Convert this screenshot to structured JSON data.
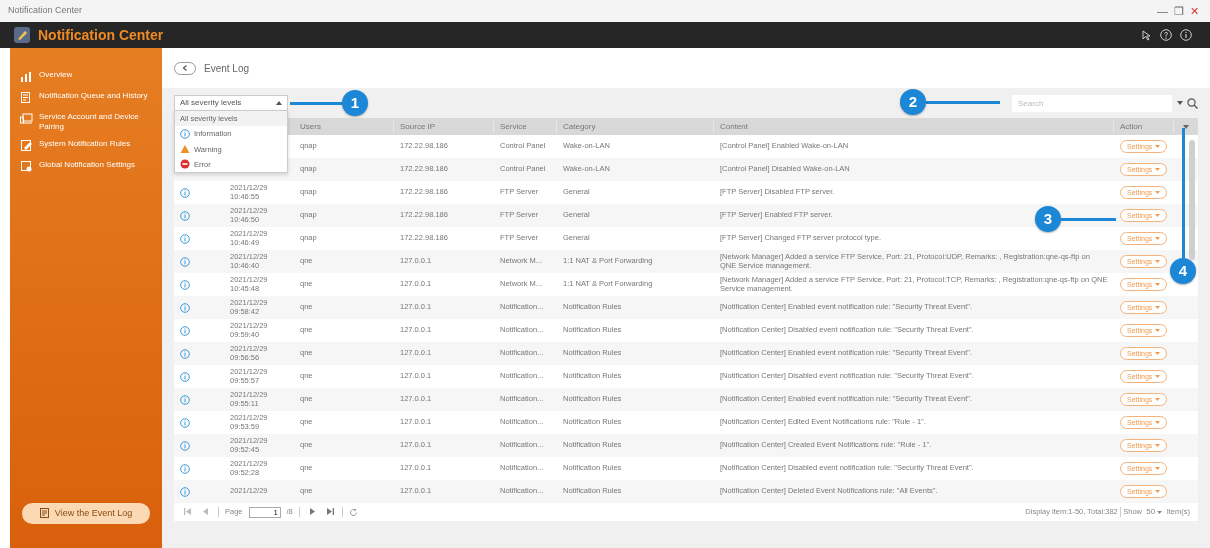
{
  "window": {
    "title": "Notification Center",
    "controls": [
      "—",
      "❐",
      "✕"
    ]
  },
  "header": {
    "title": "Notification Center"
  },
  "sidebar": {
    "items": [
      {
        "label": "Overview",
        "selected": false
      },
      {
        "label": "Notification Queue and History",
        "selected": false
      },
      {
        "label": "Service Account and Device Pairing",
        "selected": false
      },
      {
        "label": "System Notification Rules",
        "selected": false
      },
      {
        "label": "Global Notification Settings",
        "selected": false
      }
    ],
    "button": "View the Event Log"
  },
  "page": {
    "title": "Event Log"
  },
  "filter": {
    "value": "All severity levels",
    "expanded": true,
    "options": [
      {
        "label": "All severity levels",
        "kind": "all",
        "selected": true
      },
      {
        "label": "Information",
        "kind": "info",
        "selected": false
      },
      {
        "label": "Warning",
        "kind": "warning",
        "selected": false
      },
      {
        "label": "Error",
        "kind": "error",
        "selected": false
      }
    ]
  },
  "search": {
    "placeholder": "Search"
  },
  "table": {
    "columns": [
      "Users",
      "Source IP",
      "Service",
      "Category",
      "Content",
      "Action"
    ],
    "rows": [
      {
        "date": null,
        "time": null,
        "user": "qnap",
        "ip": "172.22.98.186",
        "service": "Control Panel",
        "category": "Wake-on-LAN",
        "content": "[Control Panel] Enabled Wake-on-LAN",
        "action": "Settings"
      },
      {
        "date": null,
        "time": null,
        "user": "qnap",
        "ip": "172.22.98.186",
        "service": "Control Panel",
        "category": "Wake-on-LAN",
        "content": "[Control Panel] Disabled Wake-on-LAN",
        "action": "Settings"
      },
      {
        "kind": "info",
        "date": "2021/12/29",
        "time": "10:46:55",
        "user": "qnap",
        "ip": "172.22.98.186",
        "service": "FTP Server",
        "category": "General",
        "content": "[FTP Server] Disabled FTP server.",
        "action": "Settings"
      },
      {
        "kind": "info",
        "date": "2021/12/29",
        "time": "10:46:50",
        "user": "qnap",
        "ip": "172.22.98.186",
        "service": "FTP Server",
        "category": "General",
        "content": "[FTP Server] Enabled FTP server.",
        "action": "Settings"
      },
      {
        "kind": "info",
        "date": "2021/12/29",
        "time": "10:46:49",
        "user": "qnap",
        "ip": "172.22.98.186",
        "service": "FTP Server",
        "category": "General",
        "content": "[FTP Server] Changed FTP server protocol type.",
        "action": "Settings"
      },
      {
        "kind": "info",
        "date": "2021/12/29",
        "time": "10:46:40",
        "user": "qne",
        "ip": "127.0.0.1",
        "service": "Network M...",
        "category": "1:1 NAT & Port Forwarding",
        "content": "[Network Manager] Added a service FTP Service, Port: 21, Protocol:UDP, Remarks: , Registration:qne-qs-ftp on QNE Service management.",
        "action": "Settings"
      },
      {
        "kind": "info",
        "date": "2021/12/29",
        "time": "10:45:48",
        "user": "qne",
        "ip": "127.0.0.1",
        "service": "Network M...",
        "category": "1:1 NAT & Port Forwarding",
        "content": "[Network Manager] Added a service FTP Service, Port: 21, Protocol:TCP, Remarks: , Registration:qne-qs-ftp on QNE Service management.",
        "action": "Settings"
      },
      {
        "kind": "info",
        "date": "2021/12/29",
        "time": "09:58:42",
        "user": "qne",
        "ip": "127.0.0.1",
        "service": "Notification...",
        "category": "Notification Rules",
        "content": "[Notification Center] Enabled event notification rule: \"Security Threat Event\".",
        "action": "Settings"
      },
      {
        "kind": "info",
        "date": "2021/12/29",
        "time": "09:59:40",
        "user": "qne",
        "ip": "127.0.0.1",
        "service": "Notification...",
        "category": "Notification Rules",
        "content": "[Notification Center] Disabled event notification rule: \"Security Threat Event\".",
        "action": "Settings"
      },
      {
        "kind": "info",
        "date": "2021/12/29",
        "time": "09:56:56",
        "user": "qne",
        "ip": "127.0.0.1",
        "service": "Notification...",
        "category": "Notification Rules",
        "content": "[Notification Center] Enabled event notification rule: \"Security Threat Event\".",
        "action": "Settings"
      },
      {
        "kind": "info",
        "date": "2021/12/29",
        "time": "09:55:57",
        "user": "qne",
        "ip": "127.0.0.1",
        "service": "Notification...",
        "category": "Notification Rules",
        "content": "[Notification Center] Disabled event notification rule: \"Security Threat Event\".",
        "action": "Settings"
      },
      {
        "kind": "info",
        "date": "2021/12/29",
        "time": "09:55:11",
        "user": "qne",
        "ip": "127.0.0.1",
        "service": "Notification...",
        "category": "Notification Rules",
        "content": "[Notification Center] Enabled event notification rule: \"Security Threat Event\".",
        "action": "Settings"
      },
      {
        "kind": "info",
        "date": "2021/12/29",
        "time": "09:53:59",
        "user": "qne",
        "ip": "127.0.0.1",
        "service": "Notification...",
        "category": "Notification Rules",
        "content": "[Notification Center] Edited Event Notifications rule: \"Rule - 1\".",
        "action": "Settings"
      },
      {
        "kind": "info",
        "date": "2021/12/29",
        "time": "09:52:45",
        "user": "qne",
        "ip": "127.0.0.1",
        "service": "Notification...",
        "category": "Notification Rules",
        "content": "[Notification Center] Created Event Notifications rule: \"Rule - 1\".",
        "action": "Settings"
      },
      {
        "kind": "info",
        "date": "2021/12/29",
        "time": "09:52:28",
        "user": "qne",
        "ip": "127.0.0.1",
        "service": "Notification...",
        "category": "Notification Rules",
        "content": "[Notification Center] Disabled event notification rule: \"Security Threat Event\".",
        "action": "Settings"
      },
      {
        "kind": "info",
        "date": "2021/12/29",
        "time": null,
        "user": "qne",
        "ip": "127.0.0.1",
        "service": "Notification...",
        "category": "Notification Rules",
        "content": "[Notification Center] Deleted Event Notifications rule: \"All Events\".",
        "action": "Settings"
      }
    ]
  },
  "pager": {
    "label": "Page",
    "page": "1",
    "total_pages": "/8",
    "summary": "Display item:1-50, Total:382",
    "show_label": "Show",
    "show_value": "50",
    "items_label": "Item(s)"
  },
  "callouts": [
    {
      "label": "1"
    },
    {
      "label": "2"
    },
    {
      "label": "3"
    },
    {
      "label": "4"
    }
  ]
}
